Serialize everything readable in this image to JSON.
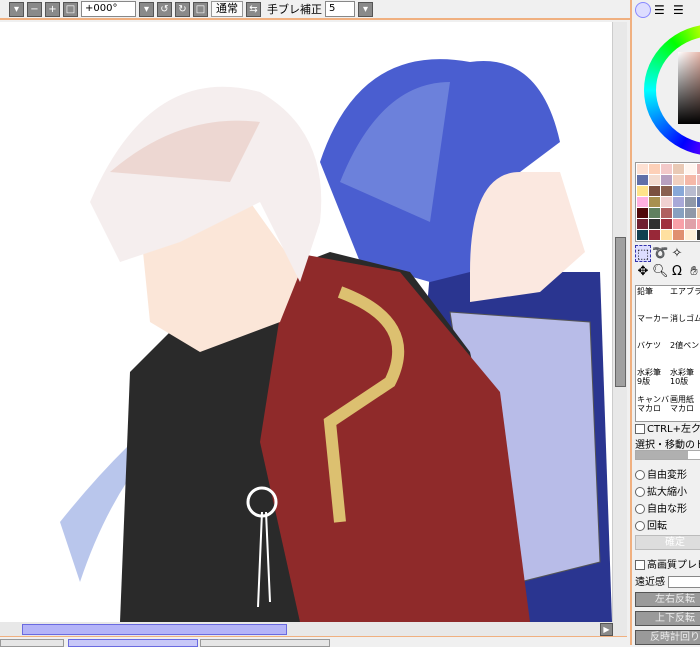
{
  "toolbar": {
    "rotation": "+000°",
    "blend_mode": "通常",
    "stabilizer_label": "手ブレ補正",
    "stabilizer_value": "5"
  },
  "panel": {
    "palette": [
      "#fde0d2",
      "#fdd0b8",
      "#f3c9c9",
      "#e9c9b5",
      "#fff5ef",
      "#e8b0b0",
      "#6070a8",
      "#f3dcd0",
      "#b8a0c0",
      "#f1d0c0",
      "#f5b8a8",
      "#f0c0c0",
      "#ffe48a",
      "#7a5040",
      "#8a6050",
      "#88a8d8",
      "#b8bcd0",
      "#b0b0b8",
      "#ffb0e0",
      "#a89050",
      "#f0d0d0",
      "#a8a8d8",
      "#9098a8",
      "#5870b0",
      "#500808",
      "#608060",
      "#b06060",
      "#88a0c0",
      "#9098a8",
      "#f0c8a8",
      "#702030",
      "#303030",
      "#a03040",
      "#f8a0a8",
      "#e0a0a8",
      "#ffa8b0",
      "#104050",
      "#982838",
      "#ffe0a0",
      "#e09070",
      "#fff0d8",
      "#303030"
    ],
    "brushes": [
      "鉛筆",
      "エアブラシ",
      "マーカー",
      "消しゴム",
      "バケツ",
      "2値ペン",
      "水彩筆\n9版",
      "水彩筆\n10版",
      "キャンバス\nマカロ",
      "画用紙\nマカロ"
    ],
    "ctrl_click": "CTRL+左クリック",
    "drag_label": "選択・移動のドラッグ",
    "transform_modes": [
      "自由変形",
      "拡大縮小",
      "自由な形",
      "回転"
    ],
    "confirm": "確定",
    "hq_preview": "高画質プレビュー",
    "perspective": "遠近感",
    "flip_h": "左右反転",
    "flip_v": "上下反転",
    "rotate_ccw": "反時計回り"
  },
  "colors": {
    "accent": "#f0b080",
    "scroll_thumb": "#b4b4f8",
    "red_coat": "#8f2a2a",
    "blue_hair": "#4a5ed0"
  }
}
